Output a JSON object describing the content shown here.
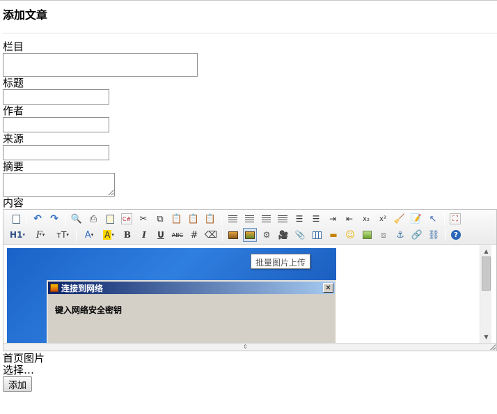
{
  "page": {
    "title": "添加文章"
  },
  "form": {
    "category_label": "栏目",
    "title_label": "标题",
    "author_label": "作者",
    "source_label": "来源",
    "summary_label": "摘要",
    "content_label": "内容",
    "cover_label": "首页图片",
    "file_select_text": "选择…",
    "submit_label": "添加"
  },
  "editor": {
    "toolbar": {
      "row1": [
        "source-icon",
        "undo-icon",
        "redo-icon",
        "preview-icon",
        "print-icon",
        "template-icon",
        "code-icon",
        "cut-icon",
        "copy-icon",
        "paste-icon",
        "paste-text-icon",
        "paste-word-icon",
        "align-left-icon",
        "align-center-icon",
        "align-right-icon",
        "align-justify-icon",
        "ordered-list-icon",
        "unordered-list-icon",
        "indent-icon",
        "outdent-icon",
        "subscript-icon",
        "superscript-icon",
        "clear-format-icon",
        "select-all-icon",
        "pointer-icon",
        "fullscreen-icon"
      ],
      "row2": [
        "heading-icon",
        "font-family-icon",
        "font-size-icon",
        "font-color-icon",
        "highlight-color-icon",
        "bold-icon",
        "italic-icon",
        "underline-icon",
        "strikethrough-icon",
        "line-height-icon",
        "remove-format-icon",
        "image-icon",
        "multi-image-icon",
        "flash-icon",
        "media-icon",
        "attachment-icon",
        "table-icon",
        "horizontal-rule-icon",
        "emoticon-icon",
        "template-image-icon",
        "page-break-icon",
        "anchor-icon",
        "link-icon",
        "unlink-icon",
        "help-icon"
      ],
      "heading_text": "H1",
      "font_text": "F",
      "size_text": "тT",
      "color_text": "A",
      "highlight_text": "A",
      "bold_text": "B",
      "italic_text": "I",
      "underline_text": "U",
      "strike_text": "ABC",
      "sub_text": "x₂",
      "sup_text": "x²",
      "help_text": "?"
    },
    "tooltip": "批量图片上传",
    "content_image": {
      "dialog_title": "连接到网络",
      "dialog_text": "键入网络安全密钥",
      "close_text": "✕"
    }
  }
}
